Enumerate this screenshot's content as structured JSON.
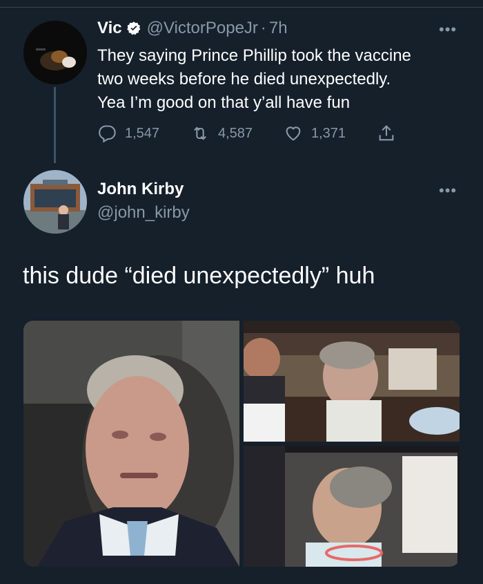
{
  "tweet1": {
    "display_name": "Vic",
    "handle": "@VictorPopeJr",
    "separator": "·",
    "time": "7h",
    "text_lines": [
      "They saying Prince Phillip took the vaccine",
      "two weeks before he died unexpectedly.",
      "Yea I’m good on that y’all have fun"
    ],
    "stats": {
      "replies": "1,547",
      "retweets": "4,587",
      "likes": "1,371"
    }
  },
  "tweet2": {
    "display_name": "John Kirby",
    "handle": "@john_kirby",
    "text": "this dude “died unexpectedly” huh"
  },
  "colors": {
    "background": "#15202b",
    "secondary_text": "#8899a6",
    "verified": "#ffffff",
    "divider": "#38444d"
  },
  "icons": [
    "verified-badge-icon",
    "more-icon",
    "reply-icon",
    "retweet-icon",
    "like-icon",
    "share-icon"
  ]
}
